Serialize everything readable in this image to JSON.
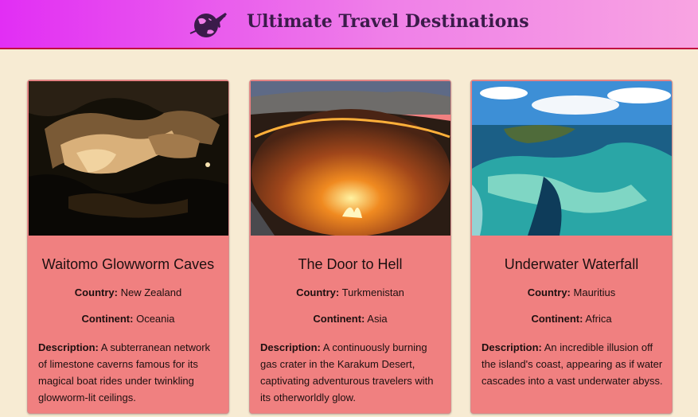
{
  "header": {
    "title": "Ultimate Travel Destinations",
    "logo_icon": "globe-airplane-icon"
  },
  "colors": {
    "gradient_start": "#e22ef4",
    "gradient_end": "#f8a4e2",
    "page_bg": "#f7ebd3",
    "card_bg": "#f08080"
  },
  "labels": {
    "country": "Country:",
    "continent": "Continent:",
    "description": "Description:"
  },
  "destinations": [
    {
      "name": "Waitomo Glowworm Caves",
      "country": "New Zealand",
      "continent": "Oceania",
      "description": "A subterranean network of limestone caverns famous for its magical boat rides under twinkling glowworm-lit ceilings."
    },
    {
      "name": "The Door to Hell",
      "country": "Turkmenistan",
      "continent": "Asia",
      "description": "A continuously burning gas crater in the Karakum Desert, captivating adventurous travelers with its otherworldly glow."
    },
    {
      "name": "Underwater Waterfall",
      "country": "Mauritius",
      "continent": "Africa",
      "description": "An incredible illusion off the island's coast, appearing as if water cascades into a vast underwater abyss."
    }
  ]
}
